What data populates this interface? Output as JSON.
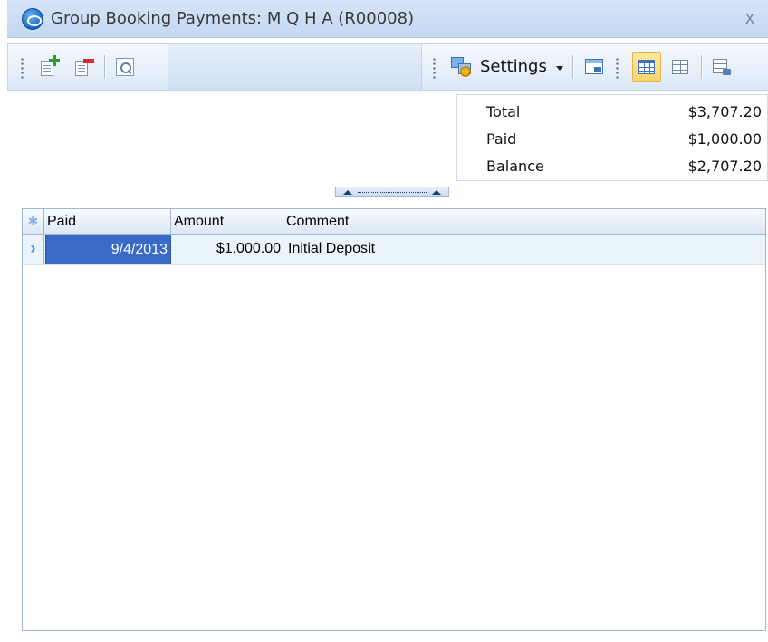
{
  "window": {
    "title": "Group Booking Payments: M Q H A (R00008)",
    "close_glyph": "x"
  },
  "toolbar": {
    "add_button": {
      "icon": "add-record-icon"
    },
    "delete_button": {
      "icon": "delete-record-icon"
    },
    "preview_button": {
      "icon": "preview-icon"
    },
    "settings_label": "Settings",
    "view_buttons": [
      {
        "icon": "window-icon"
      },
      {
        "icon": "grid-layout-icon",
        "active": true
      },
      {
        "icon": "columns-icon"
      },
      {
        "icon": "export-icon"
      }
    ]
  },
  "summary": {
    "rows": [
      {
        "label": "Total",
        "value": "$3,707.20"
      },
      {
        "label": "Paid",
        "value": "$1,000.00"
      },
      {
        "label": "Balance",
        "value": "$2,707.20"
      }
    ]
  },
  "grid": {
    "columns": [
      "Paid",
      "Amount",
      "Comment"
    ],
    "rows": [
      {
        "paid": "9/4/2013",
        "amount": "$1,000.00",
        "comment": "Initial Deposit"
      }
    ]
  },
  "colors": {
    "selection": "#3a6ac8",
    "row_background": "#e9f4fb",
    "toolbar_accent": "#ffd36b"
  }
}
